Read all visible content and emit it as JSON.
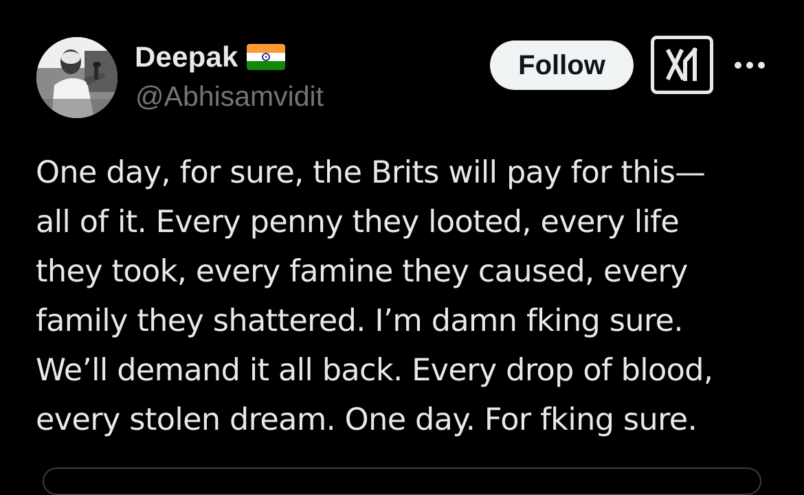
{
  "author": {
    "display_name": "Deepak",
    "flag_icon": "india-flag-icon",
    "handle": "@Abhisamvidit"
  },
  "actions": {
    "follow_label": "Follow",
    "grok_icon": "grok-icon",
    "more_icon": "more-options-icon"
  },
  "tweet": {
    "lines": [
      "One day, for sure, the Brits will pay for this—",
      "all of it. Every penny they looted, every life",
      "they took, every famine they caused, every",
      "family they shattered. I’m damn fking sure.",
      "We’ll demand it all back. Every drop of blood,",
      "every stolen dream. One day. For fking sure."
    ]
  },
  "colors": {
    "background": "#000000",
    "primary_text": "#e7e9ea",
    "secondary_text": "#71767b",
    "follow_bg": "#eff3f4",
    "follow_text": "#0f1419"
  }
}
